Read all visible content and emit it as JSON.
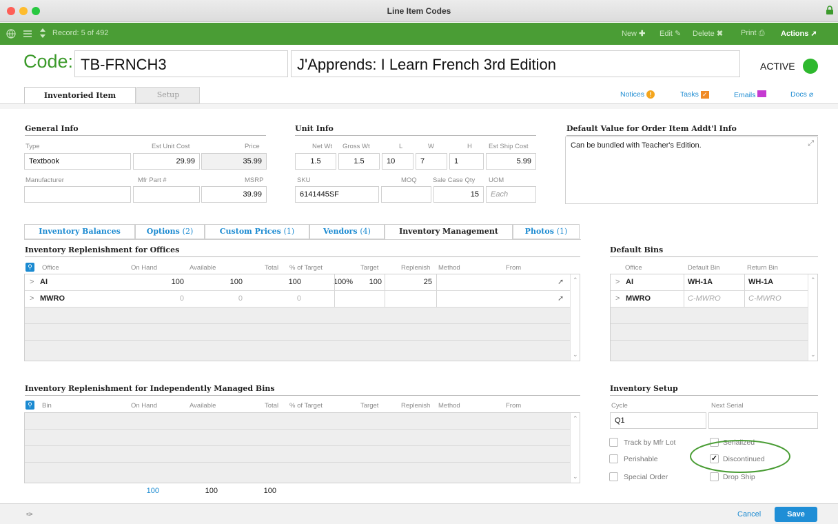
{
  "window": {
    "title": "Line Item Codes"
  },
  "toolbar": {
    "record": "Record: 5 of 492",
    "new": "New",
    "edit": "Edit",
    "delete": "Delete",
    "print": "Print",
    "actions": "Actions"
  },
  "header": {
    "code_label": "Code:",
    "code": "TB-FRNCH3",
    "description": "J'Apprends: I Learn French 3rd Edition",
    "status": "ACTIVE",
    "status_color": "#2eb82e"
  },
  "tabs": {
    "inventoried": "Inventoried Item",
    "setup": "Setup"
  },
  "links": {
    "notices": "Notices",
    "tasks": "Tasks",
    "emails": "Emails",
    "docs": "Docs"
  },
  "general": {
    "heading": "General Info",
    "type_label": "Type",
    "type": "Textbook",
    "est_unit_cost_label": "Est Unit Cost",
    "est_unit_cost": "29.99",
    "price_label": "Price",
    "price": "35.99",
    "manufacturer_label": "Manufacturer",
    "manufacturer": "",
    "mfr_part_label": "Mfr Part #",
    "mfr_part": "",
    "msrp_label": "MSRP",
    "msrp": "39.99"
  },
  "unit": {
    "heading": "Unit Info",
    "net_wt_label": "Net Wt",
    "net_wt": "1.5",
    "gross_wt_label": "Gross Wt",
    "gross_wt": "1.5",
    "l_label": "L",
    "l": "10",
    "w_label": "W",
    "w": "7",
    "h_label": "H",
    "h": "1",
    "ship_cost_label": "Est Ship Cost",
    "ship_cost": "5.99",
    "sku_label": "SKU",
    "sku": "6141445SF",
    "moq_label": "MOQ",
    "moq": "",
    "case_qty_label": "Sale Case Qty",
    "case_qty": "15",
    "uom_label": "UOM",
    "uom_placeholder": "Each"
  },
  "default_value": {
    "heading": "Default Value for Order Item Addt'l Info",
    "text": "Can be bundled with Teacher's Edition."
  },
  "lower_tabs": [
    {
      "name": "Inventory Balances",
      "count": ""
    },
    {
      "name": "Options",
      "count": "(2)"
    },
    {
      "name": "Custom Prices",
      "count": "(1)"
    },
    {
      "name": "Vendors",
      "count": "(4)"
    },
    {
      "name": "Inventory Management",
      "count": ""
    },
    {
      "name": "Photos",
      "count": "(1)"
    }
  ],
  "offices": {
    "heading": "Inventory Replenishment for Offices",
    "columns": [
      "Office",
      "On Hand",
      "Available",
      "Total",
      "% of Target",
      "Target",
      "Replenish",
      "Method",
      "From"
    ],
    "rows": [
      {
        "office": "AI",
        "on_hand": "100",
        "available": "100",
        "total": "100",
        "pct": "100%",
        "target": "100",
        "replenish": "25"
      },
      {
        "office": "MWRO",
        "on_hand": "0",
        "available": "0",
        "total": "0",
        "pct": "",
        "target": "",
        "replenish": ""
      }
    ]
  },
  "bins_table": {
    "heading": "Inventory Replenishment for Independently Managed Bins",
    "columns": [
      "Bin",
      "On Hand",
      "Available",
      "Total",
      "% of Target",
      "Target",
      "Replenish",
      "Method",
      "From"
    ],
    "totals": {
      "on_hand": "100",
      "available": "100",
      "total": "100"
    }
  },
  "default_bins": {
    "heading": "Default Bins",
    "columns": [
      "Office",
      "Default Bin",
      "Return Bin"
    ],
    "rows": [
      {
        "office": "AI",
        "default": "WH-1A",
        "return": "WH-1A"
      },
      {
        "office": "MWRO",
        "default": "C-MWRO",
        "return": "C-MWRO"
      }
    ]
  },
  "inv_setup": {
    "heading": "Inventory Setup",
    "cycle_label": "Cycle",
    "cycle": "Q1",
    "next_serial_label": "Next Serial",
    "next_serial": "",
    "checks": {
      "track_mfr_lot": "Track by Mfr Lot",
      "serialized": "Serialized",
      "perishable": "Perishable",
      "discontinued": "Discontinued",
      "special_order": "Special Order",
      "drop_ship": "Drop Ship"
    }
  },
  "footer": {
    "cancel": "Cancel",
    "save": "Save"
  }
}
